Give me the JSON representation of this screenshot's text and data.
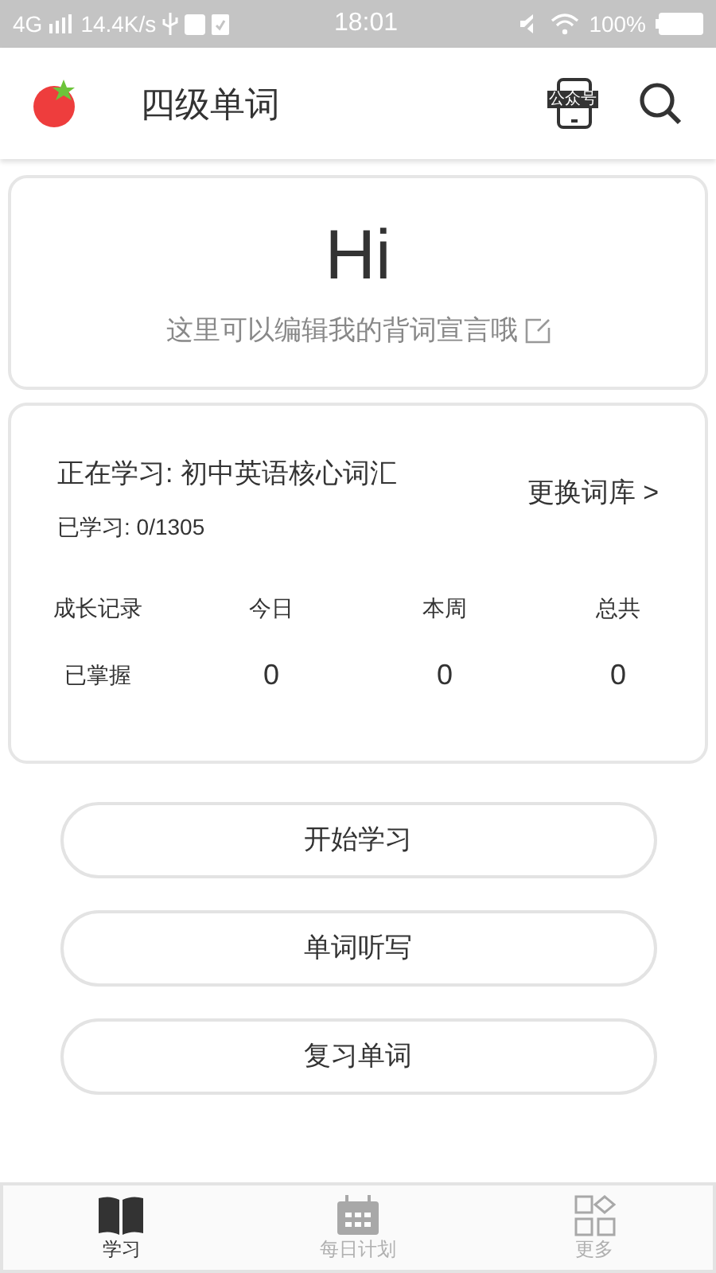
{
  "status_bar": {
    "network": "4G",
    "speed": "14.4K/s",
    "time": "18:01",
    "battery": "100%"
  },
  "header": {
    "title": "四级单词",
    "account_label": "公众号"
  },
  "motto": {
    "greeting": "Hi",
    "text": "这里可以编辑我的背词宣言哦"
  },
  "course": {
    "current": "正在学习: 初中英语核心词汇",
    "progress": "已学习: 0/1305",
    "change_link": "更换词库 >"
  },
  "stats": {
    "columns": [
      "成长记录",
      "今日",
      "本周",
      "总共"
    ],
    "rows": [
      {
        "label": "已掌握",
        "values": [
          "0",
          "0",
          "0"
        ]
      }
    ]
  },
  "actions": [
    "开始学习",
    "单词听写",
    "复习单词"
  ],
  "tabs": [
    {
      "label": "学习",
      "kind": "book",
      "selected": true
    },
    {
      "label": "每日计划",
      "kind": "calendar",
      "selected": false
    },
    {
      "label": "更多",
      "kind": "grid",
      "selected": false
    }
  ]
}
